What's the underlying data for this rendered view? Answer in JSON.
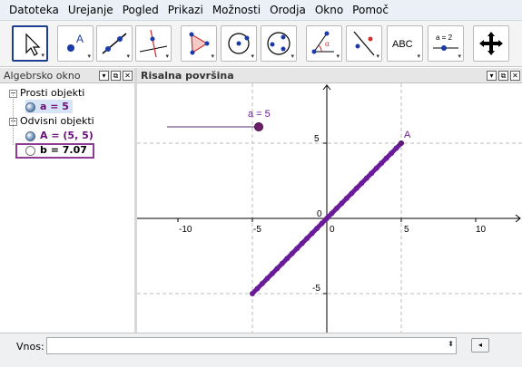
{
  "menu": [
    "Datoteka",
    "Urejanje",
    "Pogled",
    "Prikazi",
    "Možnosti",
    "Orodja",
    "Okno",
    "Pomoč"
  ],
  "tools": [
    {
      "name": "move-tool-icon"
    },
    {
      "name": "point-tool-icon"
    },
    {
      "name": "line-tool-icon"
    },
    {
      "name": "perpendicular-tool-icon"
    },
    {
      "name": "polygon-tool-icon"
    },
    {
      "name": "circle-tool-icon"
    },
    {
      "name": "conic-tool-icon"
    },
    {
      "name": "angle-tool-icon"
    },
    {
      "name": "reflect-tool-icon"
    },
    {
      "name": "text-tool-icon",
      "label": "ABC"
    },
    {
      "name": "slider-tool-icon",
      "label": "a = 2"
    },
    {
      "name": "move-view-tool-icon"
    }
  ],
  "algebra": {
    "title": "Algebrsko okno",
    "free_label": "Prosti objekti",
    "free_item": "a = 5",
    "dependent_label": "Odvisni objekti",
    "dep_items": [
      "A = (5, 5)",
      "b = 7.07"
    ],
    "expand": "−"
  },
  "graphics": {
    "title": "Risalna površina",
    "slider_label": "a = 5",
    "point_label": "A",
    "x_ticks": [
      "-10",
      "-5",
      "0",
      "5",
      "10"
    ],
    "y_ticks": [
      "5",
      "-5"
    ],
    "accent": "#6a1b9a"
  },
  "header_buttons": [
    "▾",
    "⧉",
    "✕"
  ],
  "input": {
    "label": "Vnos:",
    "value": "",
    "arrow": "⬍",
    "btn": "◂"
  },
  "colors": {
    "object": "#6a0f7a",
    "selection": "#8e3c93"
  }
}
